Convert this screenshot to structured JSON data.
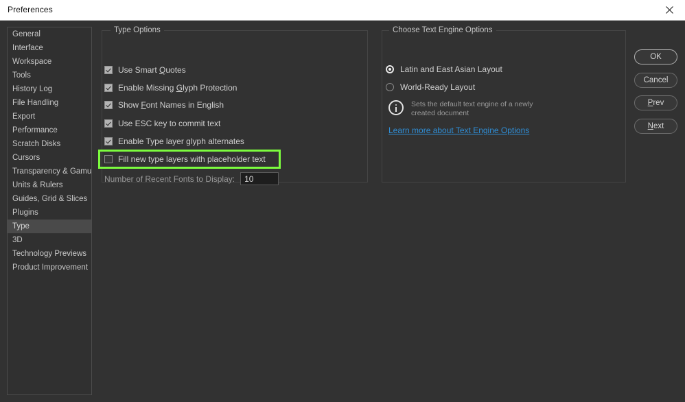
{
  "window": {
    "title": "Preferences",
    "close_icon": "close-icon"
  },
  "sidebar": {
    "items": [
      {
        "label": "General",
        "selected": false
      },
      {
        "label": "Interface",
        "selected": false
      },
      {
        "label": "Workspace",
        "selected": false
      },
      {
        "label": "Tools",
        "selected": false
      },
      {
        "label": "History Log",
        "selected": false
      },
      {
        "label": "File Handling",
        "selected": false
      },
      {
        "label": "Export",
        "selected": false
      },
      {
        "label": "Performance",
        "selected": false
      },
      {
        "label": "Scratch Disks",
        "selected": false
      },
      {
        "label": "Cursors",
        "selected": false
      },
      {
        "label": "Transparency & Gamut",
        "selected": false
      },
      {
        "label": "Units & Rulers",
        "selected": false
      },
      {
        "label": "Guides, Grid & Slices",
        "selected": false
      },
      {
        "label": "Plugins",
        "selected": false
      },
      {
        "label": "Type",
        "selected": true
      },
      {
        "label": "3D",
        "selected": false
      },
      {
        "label": "Technology Previews",
        "selected": false
      },
      {
        "label": "Product Improvement",
        "selected": false
      }
    ]
  },
  "type_options": {
    "title": "Type Options",
    "checkboxes": [
      {
        "label": "Use Smart Quotes",
        "accel": "Q",
        "checked": true,
        "highlighted": false
      },
      {
        "label": "Enable Missing Glyph Protection",
        "accel": "G",
        "checked": true,
        "highlighted": false
      },
      {
        "label": "Show Font Names in English",
        "accel": "F",
        "checked": true,
        "highlighted": false
      },
      {
        "label": "Use ESC key to commit text",
        "accel": "",
        "checked": true,
        "highlighted": false
      },
      {
        "label": "Enable Type layer glyph alternates",
        "accel": "",
        "checked": true,
        "highlighted": false
      },
      {
        "label": "Fill new type layers with placeholder text",
        "accel": "",
        "checked": false,
        "highlighted": true
      }
    ],
    "recent_fonts": {
      "label": "Number of Recent Fonts to Display:",
      "value": "10",
      "placeholder": "10"
    }
  },
  "text_engine": {
    "title": "Choose Text Engine Options",
    "radios": [
      {
        "label": "Latin and East Asian Layout",
        "selected": true
      },
      {
        "label": "World-Ready Layout",
        "selected": false
      }
    ],
    "info_icon": "info-icon",
    "info_text": "Sets the default text engine of a newly created document",
    "link_text": "Learn more about Text Engine Options"
  },
  "buttons": [
    {
      "label": "OK",
      "accel": "",
      "default": true
    },
    {
      "label": "Cancel",
      "accel": "",
      "default": false
    },
    {
      "label": "Prev",
      "accel": "P",
      "default": false
    },
    {
      "label": "Next",
      "accel": "N",
      "default": false
    }
  ],
  "colors": {
    "highlight": "#7cfc3e",
    "link": "#2f8fd8",
    "dialog_bg": "#323232",
    "titlebar_bg": "#ffffff"
  }
}
